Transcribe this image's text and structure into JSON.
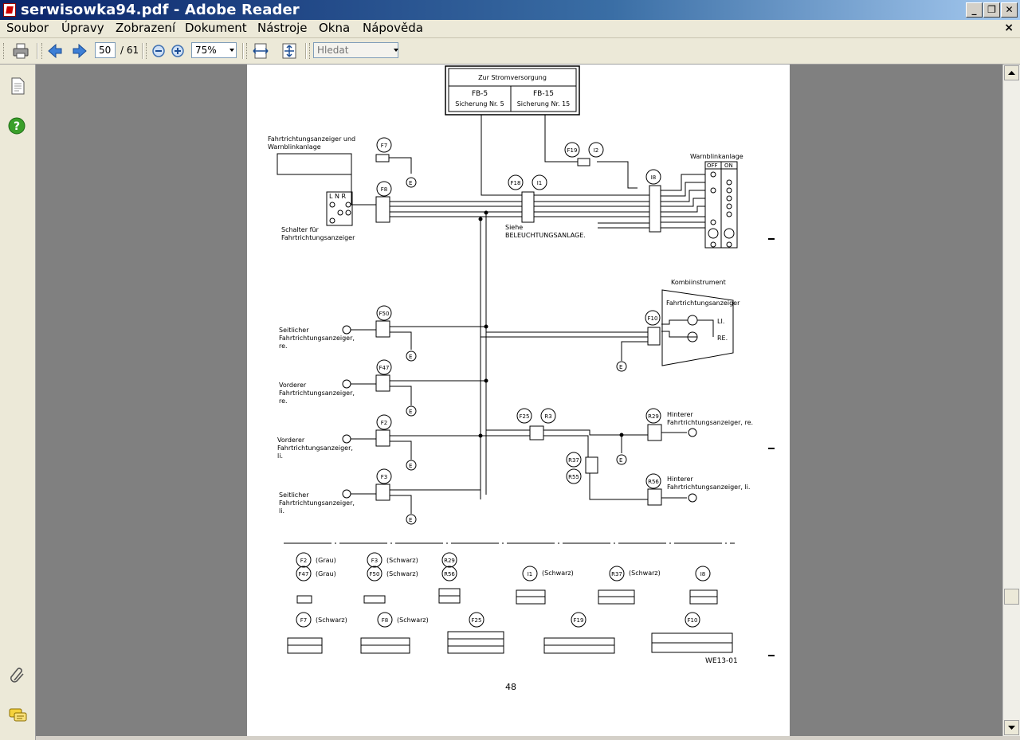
{
  "window": {
    "title": "serwisowka94.pdf - Adobe Reader"
  },
  "menu": {
    "items": [
      "Soubor",
      "Úpravy",
      "Zobrazení",
      "Dokument",
      "Nástroje",
      "Okna",
      "Nápověda"
    ]
  },
  "toolbar": {
    "page_current": "50",
    "page_total": "/ 61",
    "zoom": "75%",
    "search_placeholder": "Hledat"
  },
  "page": {
    "page_number": "48",
    "figure_code": "WE13-01",
    "power": {
      "header": "Zur Stromversorgung",
      "left_a": "FB-5",
      "left_b": "Sicherung Nr. 5",
      "right_a": "FB-15",
      "right_b": "Sicherung Nr. 15"
    },
    "labels": {
      "hazard_switch_1": "Fahrtrichtungsanzeiger und",
      "hazard_switch_2": "Warnblinkanlage",
      "turn_switch_1": "Schalter für",
      "turn_switch_2": "Fahrtrichtungsanzeiger",
      "lighting_1": "Siehe",
      "lighting_2": "BELEUCHTUNGSANLAGE.",
      "hazard_unit": "Warnblinkanlage",
      "hazard_off": "OFF",
      "hazard_on": "ON",
      "cluster": "Kombiinstrument",
      "cluster_sub": "Fahrtrichtungsanzeiger",
      "cluster_left": "LI.",
      "cluster_right": "RE.",
      "side_re_1": "Seitlicher",
      "side_re_2": "Fahrtrichtungsanzeiger,",
      "side_re_3": "re.",
      "front_re_1": "Vorderer",
      "front_re_2": "Fahrtrichtungsanzeiger,",
      "front_re_3": "re.",
      "front_li_1": "Vorderer",
      "front_li_2": "Fahrtrichtungsanzeiger,",
      "front_li_3": "li.",
      "side_li_1": "Seitlicher",
      "side_li_2": "Fahrtrichtungsanzeiger,",
      "side_li_3": "li.",
      "rear_re_1": "Hinterer",
      "rear_re_2": "Fahrtrichtungsanzeiger, re.",
      "rear_li_1": "Hinterer",
      "rear_li_2": "Fahrtrichtungsanzeiger, li."
    },
    "connectors": {
      "F7": "F7",
      "F8": "F8",
      "F18": "F18",
      "I1": "I1",
      "F19": "F19",
      "I2": "I2",
      "I8": "I8",
      "F10": "F10",
      "F50": "F50",
      "F47": "F47",
      "F2": "F2",
      "F3": "F3",
      "F25": "F25",
      "R3": "R3",
      "R29": "R29",
      "R37": "R37",
      "R55": "R55",
      "R56": "R56"
    },
    "legend": {
      "f2": "(Grau)",
      "f47": "(Grau)",
      "f3": "(Schwarz)",
      "f50": "(Schwarz)",
      "i1": "(Schwarz)",
      "r37": "(Schwarz)",
      "f7": "(Schwarz)",
      "f8": "(Schwarz)"
    }
  }
}
